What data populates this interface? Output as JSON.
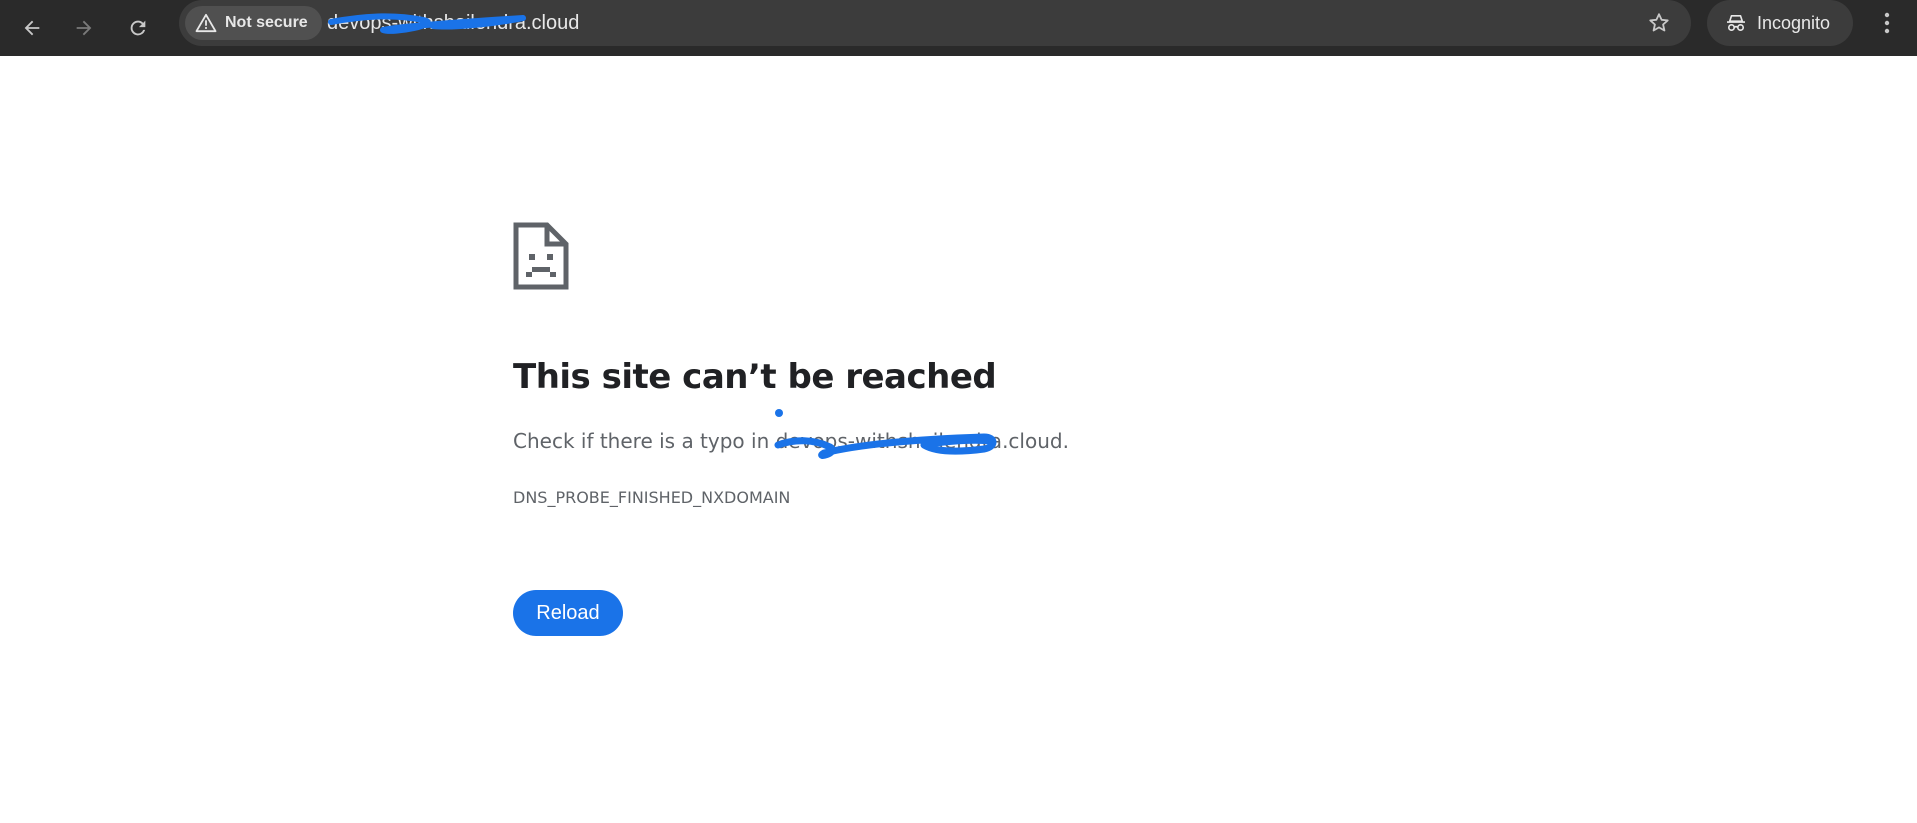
{
  "browser": {
    "back_icon": "arrow-left-icon",
    "forward_icon": "arrow-right-icon",
    "reload_icon": "reload-icon",
    "security_label": "Not secure",
    "security_icon": "warning-triangle-icon",
    "url": "devops-withshailendra.cloud",
    "bookmark_icon": "star-icon",
    "incognito_label": "Incognito",
    "incognito_icon": "incognito-icon",
    "menu_icon": "kebab-menu-icon",
    "toolbar_color": "#2a2a2a",
    "omnibox_color": "#3c3c3c"
  },
  "error_page": {
    "icon": "sad-page-icon",
    "headline": "This site can’t be reached",
    "suggestion_prefix": "Check if there is a typo in ",
    "suggestion_domain": "devops-withshailendra.cloud",
    "suggestion_suffix": ".",
    "error_code": "DNS_PROBE_FINISHED_NXDOMAIN",
    "reload_label": "Reload",
    "accent_color": "#1a73e8"
  },
  "annotations": {
    "redaction_color": "#1a73e8"
  }
}
